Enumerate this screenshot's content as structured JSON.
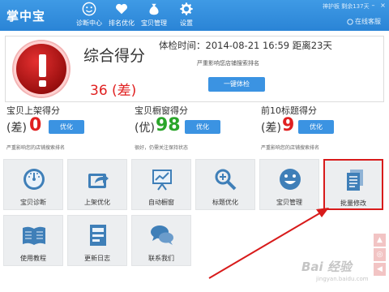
{
  "header": {
    "app_title": "掌中宝",
    "nav": [
      {
        "label": "诊断中心",
        "icon": "smiley-icon"
      },
      {
        "label": "排名优化",
        "icon": "heart-icon"
      },
      {
        "label": "宝贝管理",
        "icon": "money-bag-icon"
      },
      {
        "label": "设置",
        "icon": "gear-icon"
      }
    ],
    "user_line": "神护板 剩余137天",
    "service_link": "在线客服"
  },
  "score": {
    "title": "综合得分",
    "value": "36 (差)",
    "exam_time": "体检时间：2014-08-21 16:59 距离23天",
    "warning": "严重影响您店铺搜索排名",
    "exam_button": "一键体检",
    "icon": "danger-exclamation-icon"
  },
  "subscores": [
    {
      "title": "宝贝上架得分",
      "prefix": "(差)",
      "value": "0",
      "button": "优化",
      "desc": "严重影响您的店铺搜索排名",
      "color": "#e02020"
    },
    {
      "title": "宝贝橱窗得分",
      "prefix": "(优)",
      "value": "98",
      "button": "优化",
      "desc": "很好，仍需关注保持状态",
      "color": "#2aa52a"
    },
    {
      "title": "前10标题得分",
      "prefix": "(差)",
      "value": "9",
      "button": "优化",
      "desc": "严重影响您的店铺搜索排名",
      "color": "#e02020"
    }
  ],
  "tiles": [
    {
      "label": "宝贝诊断",
      "icon": "gauge-icon"
    },
    {
      "label": "上架优化",
      "icon": "share-icon"
    },
    {
      "label": "自动橱窗",
      "icon": "presentation-chart-icon"
    },
    {
      "label": "标题优化",
      "icon": "magnifier-icon"
    },
    {
      "label": "宝贝管理",
      "icon": "smiley-face-icon"
    },
    {
      "label": "批量修改",
      "icon": "documents-icon"
    },
    {
      "label": "使用教程",
      "icon": "open-book-icon"
    },
    {
      "label": "更新日志",
      "icon": "log-file-icon"
    },
    {
      "label": "联系我们",
      "icon": "chat-bubbles-icon"
    }
  ],
  "watermark": "Bai 经验",
  "watermark_sub": "jingyan.baidu.com",
  "colors": {
    "accent": "#3b93e2",
    "danger": "#e02020",
    "good": "#2aa52a",
    "highlight": "#d81b1b"
  }
}
